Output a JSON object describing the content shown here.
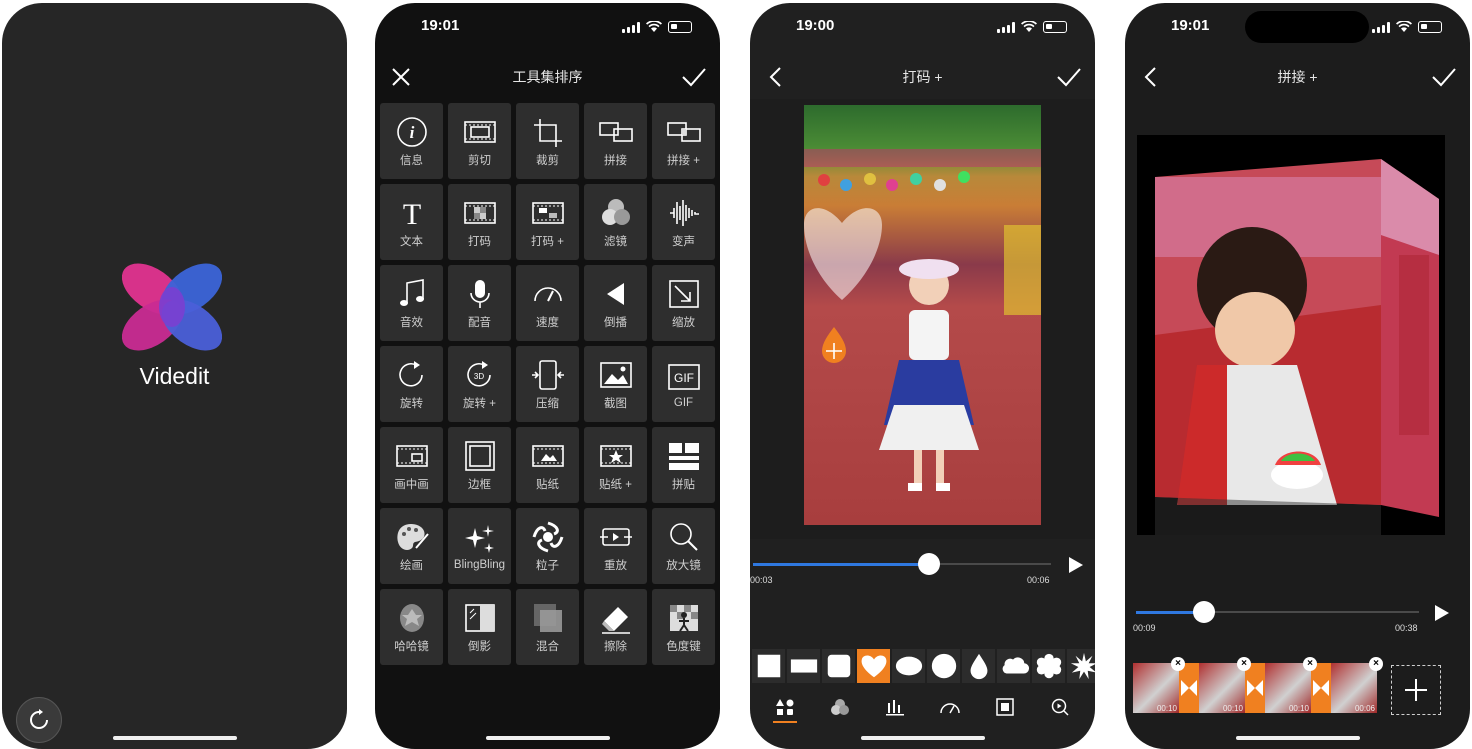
{
  "phone1": {
    "app_name": "Videdit",
    "logo_colors": [
      "#e0338f",
      "#8a3bd8",
      "#3b64d8"
    ]
  },
  "phone2": {
    "status_time": "19:01",
    "title": "工具集排序",
    "tools": [
      {
        "label": "信息",
        "icon": "info-icon"
      },
      {
        "label": "剪切",
        "icon": "film-cut-icon"
      },
      {
        "label": "裁剪",
        "icon": "crop-icon"
      },
      {
        "label": "拼接",
        "icon": "join-icon"
      },
      {
        "label": "拼接 +",
        "icon": "join-plus-icon"
      },
      {
        "label": "文本",
        "icon": "text-icon"
      },
      {
        "label": "打码",
        "icon": "mosaic-icon"
      },
      {
        "label": "打码 +",
        "icon": "mosaic-plus-icon"
      },
      {
        "label": "滤镜",
        "icon": "filter-icon"
      },
      {
        "label": "变声",
        "icon": "voice-change-icon"
      },
      {
        "label": "音效",
        "icon": "music-note-icon"
      },
      {
        "label": "配音",
        "icon": "microphone-icon"
      },
      {
        "label": "速度",
        "icon": "speedometer-icon"
      },
      {
        "label": "倒播",
        "icon": "reverse-play-icon"
      },
      {
        "label": "缩放",
        "icon": "scale-icon"
      },
      {
        "label": "旋转",
        "icon": "rotate-icon"
      },
      {
        "label": "旋转 +",
        "icon": "rotate-3d-icon"
      },
      {
        "label": "压缩",
        "icon": "compress-icon"
      },
      {
        "label": "截图",
        "icon": "screenshot-icon"
      },
      {
        "label": "GIF",
        "icon": "gif-icon"
      },
      {
        "label": "画中画",
        "icon": "picture-in-picture-icon"
      },
      {
        "label": "边框",
        "icon": "border-icon"
      },
      {
        "label": "贴纸",
        "icon": "sticker-icon"
      },
      {
        "label": "贴纸 +",
        "icon": "sticker-plus-icon"
      },
      {
        "label": "拼贴",
        "icon": "collage-icon"
      },
      {
        "label": "绘画",
        "icon": "palette-icon"
      },
      {
        "label": "BlingBling",
        "icon": "sparkle-icon"
      },
      {
        "label": "粒子",
        "icon": "particle-icon"
      },
      {
        "label": "重放",
        "icon": "replay-icon"
      },
      {
        "label": "放大镜",
        "icon": "magnifier-icon"
      },
      {
        "label": "哈哈镜",
        "icon": "funhouse-mirror-icon"
      },
      {
        "label": "倒影",
        "icon": "reflection-icon"
      },
      {
        "label": "混合",
        "icon": "blend-icon"
      },
      {
        "label": "擦除",
        "icon": "eraser-icon"
      },
      {
        "label": "色度键",
        "icon": "chroma-key-icon"
      }
    ]
  },
  "phone3": {
    "status_time": "19:00",
    "title": "打码 +",
    "current_time": "00:03",
    "total_time": "00:06",
    "progress": 0.59,
    "accent": "#f08020",
    "shapes": [
      "square",
      "wide-rect",
      "rounded-square",
      "heart",
      "ellipse",
      "circle",
      "drop",
      "cloud",
      "flower",
      "burst"
    ],
    "selected_shape": 3,
    "tabs": [
      "shapes-icon",
      "filter-icon",
      "bars-icon",
      "gauge-icon",
      "frame-icon",
      "search-play-icon"
    ]
  },
  "phone4": {
    "status_time": "19:01",
    "title": "拼接 +",
    "current_time": "00:09",
    "total_time": "00:38",
    "progress": 0.24,
    "clips": [
      {
        "duration": "00:10"
      },
      {
        "duration": "00:10"
      },
      {
        "duration": "00:10"
      },
      {
        "duration": "00:06"
      }
    ]
  }
}
